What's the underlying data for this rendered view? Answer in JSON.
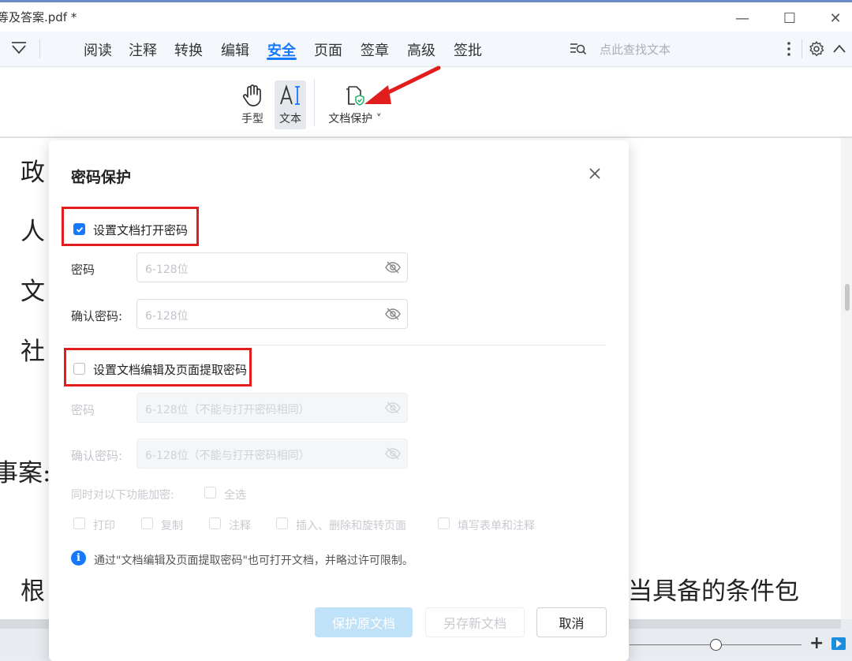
{
  "window": {
    "title": "等及答案.pdf *",
    "min_glyph": "—",
    "max_glyph": "☐",
    "close_glyph": "✕"
  },
  "menubar": {
    "tabs": [
      "阅读",
      "注释",
      "转换",
      "编辑",
      "安全",
      "页面",
      "签章",
      "高级",
      "签批"
    ],
    "active_tab": "安全",
    "search_placeholder": "点此查找文本"
  },
  "ribbon": {
    "hand_label": "手型",
    "text_label": "文本",
    "protect_label": "文档保护"
  },
  "document": {
    "chars": [
      "政",
      "人",
      "文",
      "社",
      "事案:",
      "根",
      "当具备的条件包"
    ]
  },
  "dialog": {
    "title": "密码保护",
    "open_pwd": {
      "checkbox_label": "设置文档打开密码",
      "checked": true,
      "password_label": "密码",
      "password_placeholder": "6-128位",
      "confirm_label": "确认密码:",
      "confirm_placeholder": "6-128位"
    },
    "edit_pwd": {
      "checkbox_label": "设置文档编辑及页面提取密码",
      "checked": false,
      "password_label": "密码",
      "password_placeholder": "6-128位（不能与打开密码相同）",
      "confirm_label": "确认密码:",
      "confirm_placeholder": "6-128位（不能与打开密码相同）",
      "encrypt_label": "同时对以下功能加密:",
      "select_all_label": "全选",
      "options": [
        "打印",
        "复制",
        "注释",
        "插入、删除和旋转页面",
        "填写表单和注释"
      ]
    },
    "info_text": "通过\"文档编辑及页面提取密码\"也可打开文档，并略过许可限制。",
    "buttons": {
      "protect": "保护原文档",
      "save_as": "另存新文档",
      "cancel": "取消"
    }
  },
  "colors": {
    "accent": "#1677ff",
    "highlight_red": "#e11d1d"
  }
}
